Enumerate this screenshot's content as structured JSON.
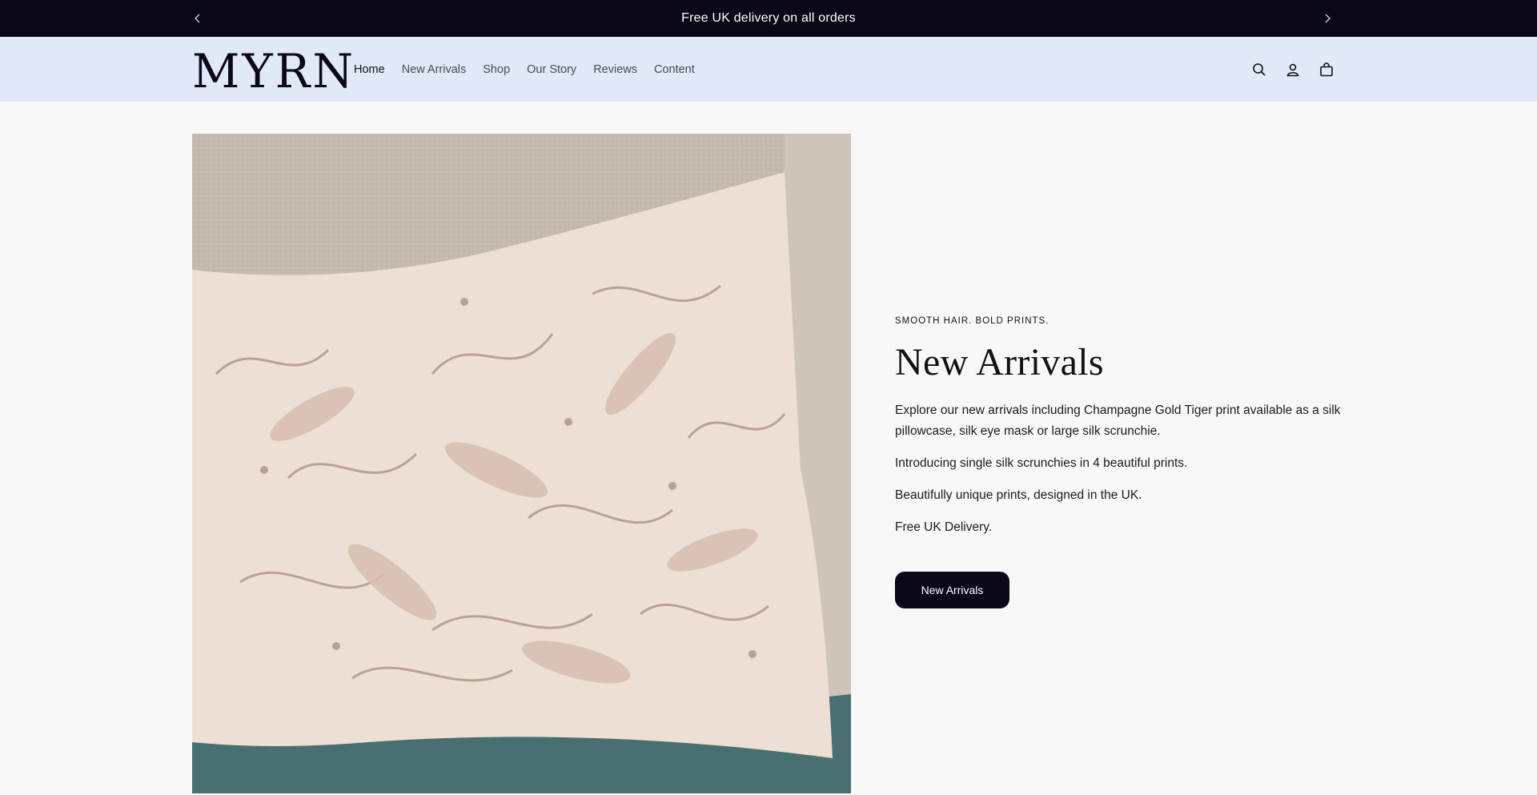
{
  "announcement": {
    "message": "Free UK delivery on all orders",
    "prev": "‹",
    "next": "›"
  },
  "header": {
    "logo": "MYRN",
    "nav": [
      {
        "label": "Home",
        "active": true
      },
      {
        "label": "New Arrivals"
      },
      {
        "label": "Shop"
      },
      {
        "label": "Our Story"
      },
      {
        "label": "Reviews"
      },
      {
        "label": "Content"
      }
    ],
    "icons": [
      "search-icon",
      "account-icon",
      "bag-icon"
    ]
  },
  "hero": {
    "eyebrow": "SMOOTH HAIR. BOLD PRINTS.",
    "title": "New Arrivals",
    "paragraphs": [
      "Explore our new arrivals including Champagne Gold Tiger print available as a silk pillowcase, silk eye mask or large silk scrunchie.",
      "Introducing single silk scrunchies in 4 beautiful prints.",
      "Beautifully unique prints, designed in the UK.",
      "Free UK Delivery."
    ],
    "button": "New Arrivals"
  },
  "colors": {
    "dark": "#0b0717",
    "header_bg": "#dfe9f7",
    "page_bg": "#f8f8f8"
  }
}
